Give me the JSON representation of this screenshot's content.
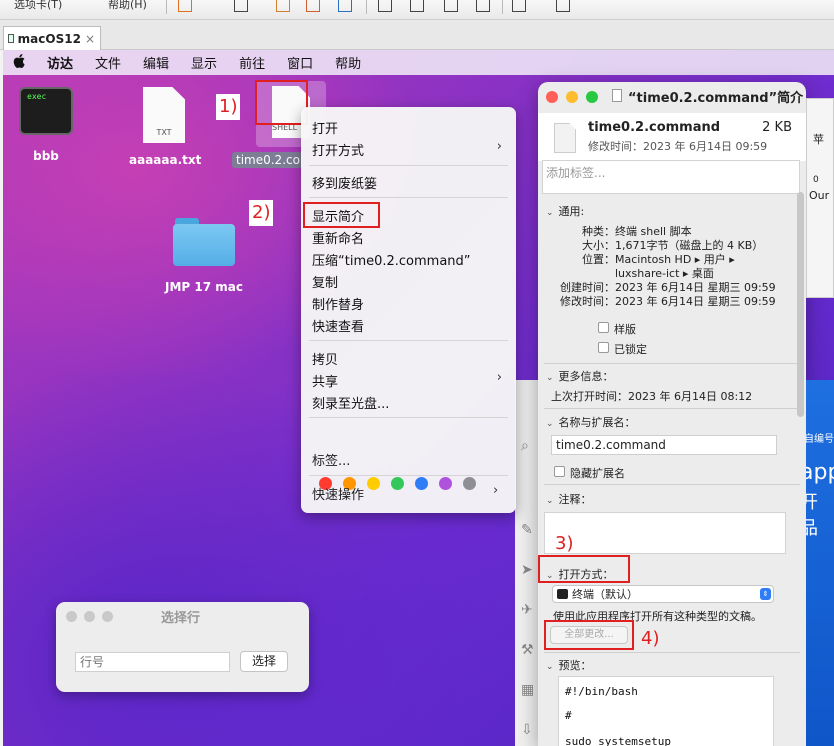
{
  "vm_toolbar": {
    "items": [
      "选项卡(T)",
      "帮助(H)"
    ]
  },
  "tab": {
    "title": "macOS12",
    "close": "×"
  },
  "menubar": {
    "apple": "",
    "items": [
      "访达",
      "文件",
      "编辑",
      "显示",
      "前往",
      "窗口",
      "帮助"
    ]
  },
  "desktop_icons": {
    "bbb": {
      "label": "bbb",
      "badge": "exec"
    },
    "txt": {
      "label": "aaaaaa.txt",
      "badge": "TXT"
    },
    "folder": {
      "label": "JMP 17 mac"
    },
    "selected": {
      "label": "time0.2.co",
      "badge": "SHELL"
    }
  },
  "annotations": [
    "1)",
    "2)",
    "3)",
    "4)"
  ],
  "context_menu": {
    "open": "打开",
    "open_with": "打开方式",
    "trash": "移到废纸篓",
    "get_info": "显示简介",
    "rename": "重新命名",
    "compress": "压缩“time0.2.command”",
    "duplicate": "复制",
    "alias": "制作替身",
    "quicklook": "快速查看",
    "copy": "拷贝",
    "share": "共享",
    "burn": "刻录至光盘...",
    "tags": "标签...",
    "quick_actions": "快速操作",
    "submenu_arrow": "›",
    "tag_colors": [
      "#ff3b30",
      "#ff9500",
      "#ffcc00",
      "#34c759",
      "#2f7df6",
      "#af52de",
      "#8e8e93"
    ]
  },
  "info_window": {
    "title": "“time0.2.command”简介",
    "file_name": "time0.2.command",
    "file_size": "2 KB",
    "modified_summary": "修改时间：2023 年 6月14日 09:59",
    "tags_placeholder": "添加标签...",
    "general": {
      "header": "通用:",
      "kind_label": "种类：",
      "kind": "终端 shell 脚本",
      "size_label": "大小：",
      "size": "1,671字节（磁盘上的 4 KB）",
      "where_label": "位置：",
      "where1": "Macintosh HD ▸ 用户 ▸",
      "where2": "luxshare-ict ▸ 桌面",
      "created_label": "创建时间：",
      "created": "2023 年 6月14日 星期三 09:59",
      "modified_label": "修改时间：",
      "modified": "2023 年 6月14日 星期三 09:59",
      "stationery": "样版",
      "locked": "已锁定"
    },
    "more_info": {
      "header": "更多信息：",
      "last_opened": "上次打开时间：2023 年 6月14日 08:12"
    },
    "name_ext": {
      "header": "名称与扩展名：",
      "value": "time0.2.command",
      "hide_ext": "隐藏扩展名"
    },
    "comments": {
      "header": "注释："
    },
    "open_with": {
      "header": "打开方式：",
      "app": "终端（默认）",
      "hint": "使用此应用程序打开所有这种类型的文稿。",
      "change_all": "全部更改..."
    },
    "preview": {
      "header": "预览：",
      "lines": [
        "#!/bin/bash",
        "#",
        "sudo systemsetup"
      ]
    }
  },
  "pick_dialog": {
    "title": "选择行",
    "placeholder": "行号",
    "button": "选择"
  },
  "right_strip": {
    "top_texts": [
      "苹",
      "0",
      "Our"
    ],
    "blue_texts": [
      "自编号",
      "app",
      "开品"
    ]
  }
}
